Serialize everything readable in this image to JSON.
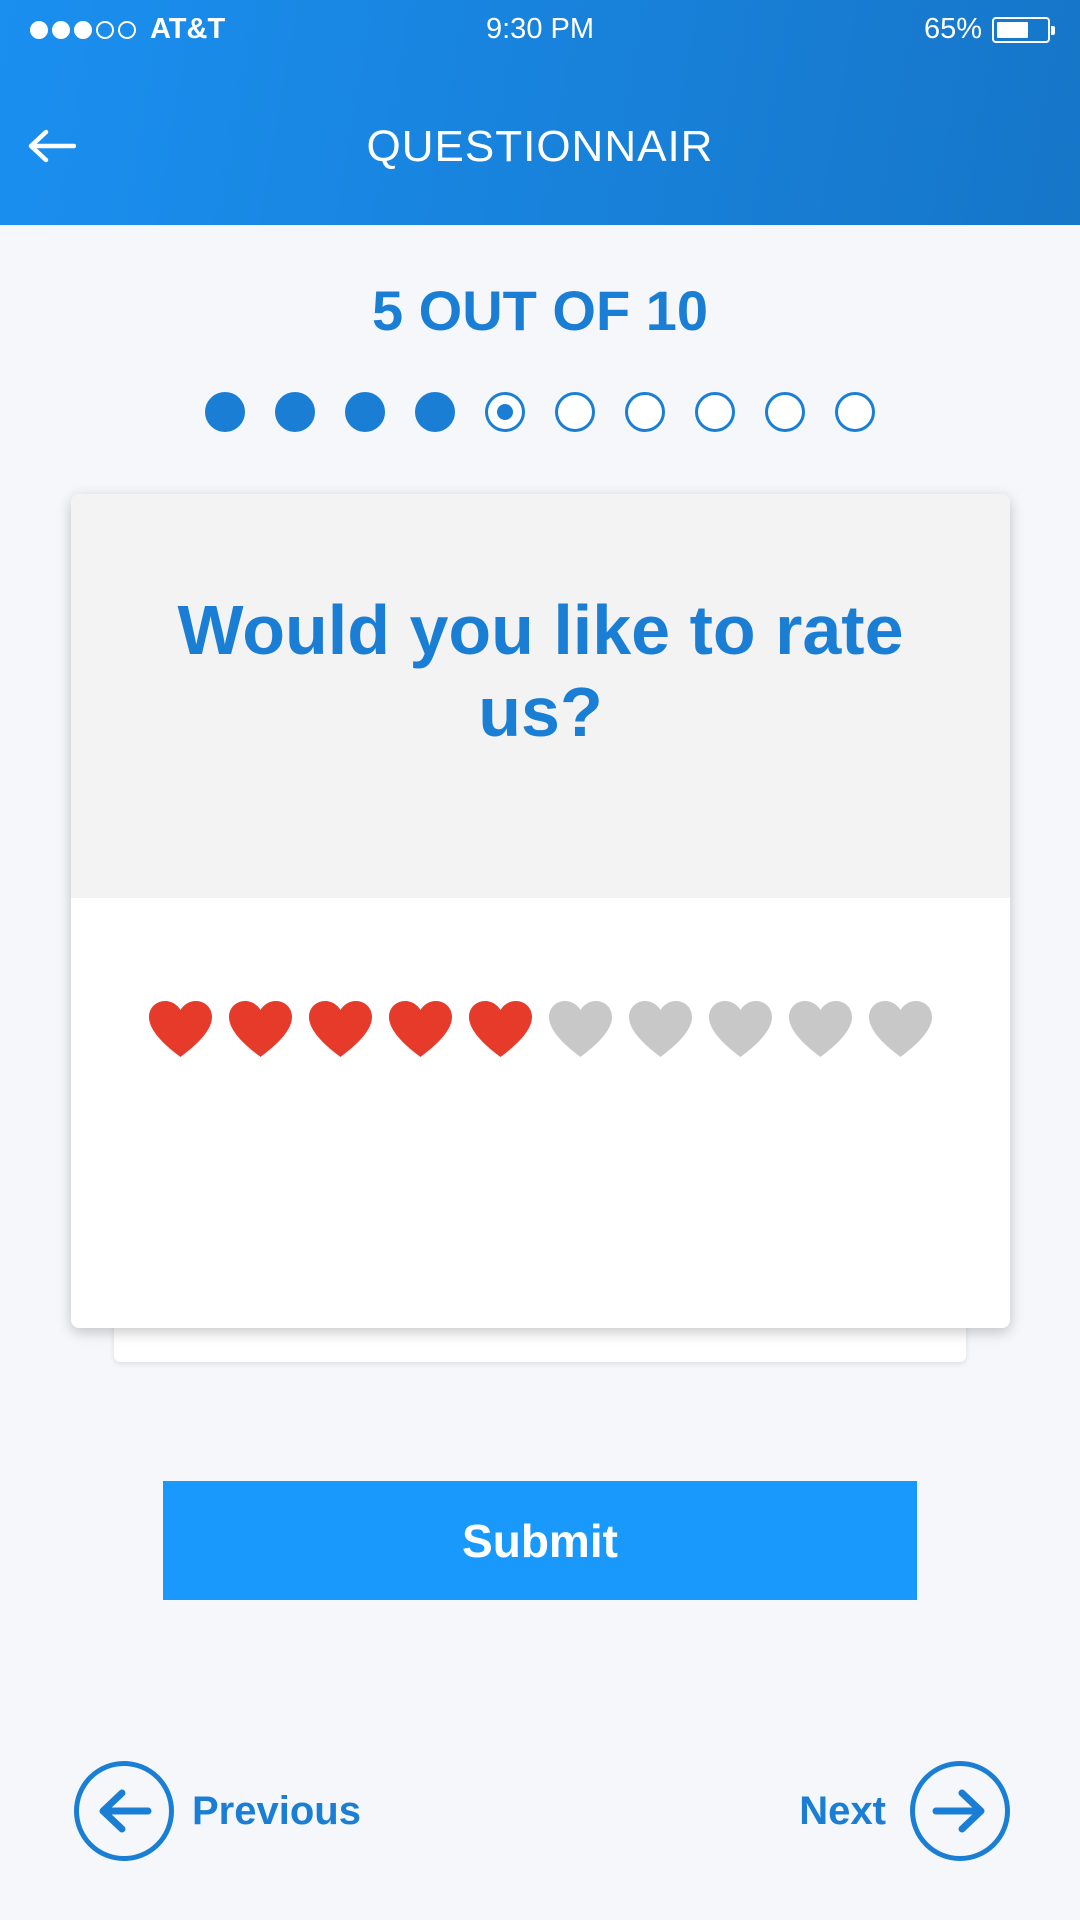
{
  "status_bar": {
    "carrier": "AT&T",
    "signal_bars_filled": 3,
    "signal_bars_total": 5,
    "time": "9:30 PM",
    "battery_percent": "65%",
    "battery_level": 0.65
  },
  "header": {
    "back_icon": "arrow-left-icon",
    "title": "QUESTIONNAIR"
  },
  "progress": {
    "label": "5 OUT OF 10",
    "current": 5,
    "total": 10
  },
  "question": {
    "text": "Would you like to rate us?"
  },
  "rating": {
    "icon": "heart-icon",
    "value": 5,
    "max": 10
  },
  "submit": {
    "label": "Submit"
  },
  "navigation": {
    "previous_label": "Previous",
    "previous_icon": "arrow-left-circle-icon",
    "next_label": "Next",
    "next_icon": "arrow-right-circle-icon"
  },
  "colors": {
    "header_start": "#1a8ff0",
    "header_end": "#1676c8",
    "accent": "#1a7fd4",
    "submit": "#1899fb",
    "heart_active": "#e63a2a",
    "heart_inactive": "#c8c8c8",
    "card_top": "#f3f3f4",
    "background": "#f5f7fb"
  }
}
